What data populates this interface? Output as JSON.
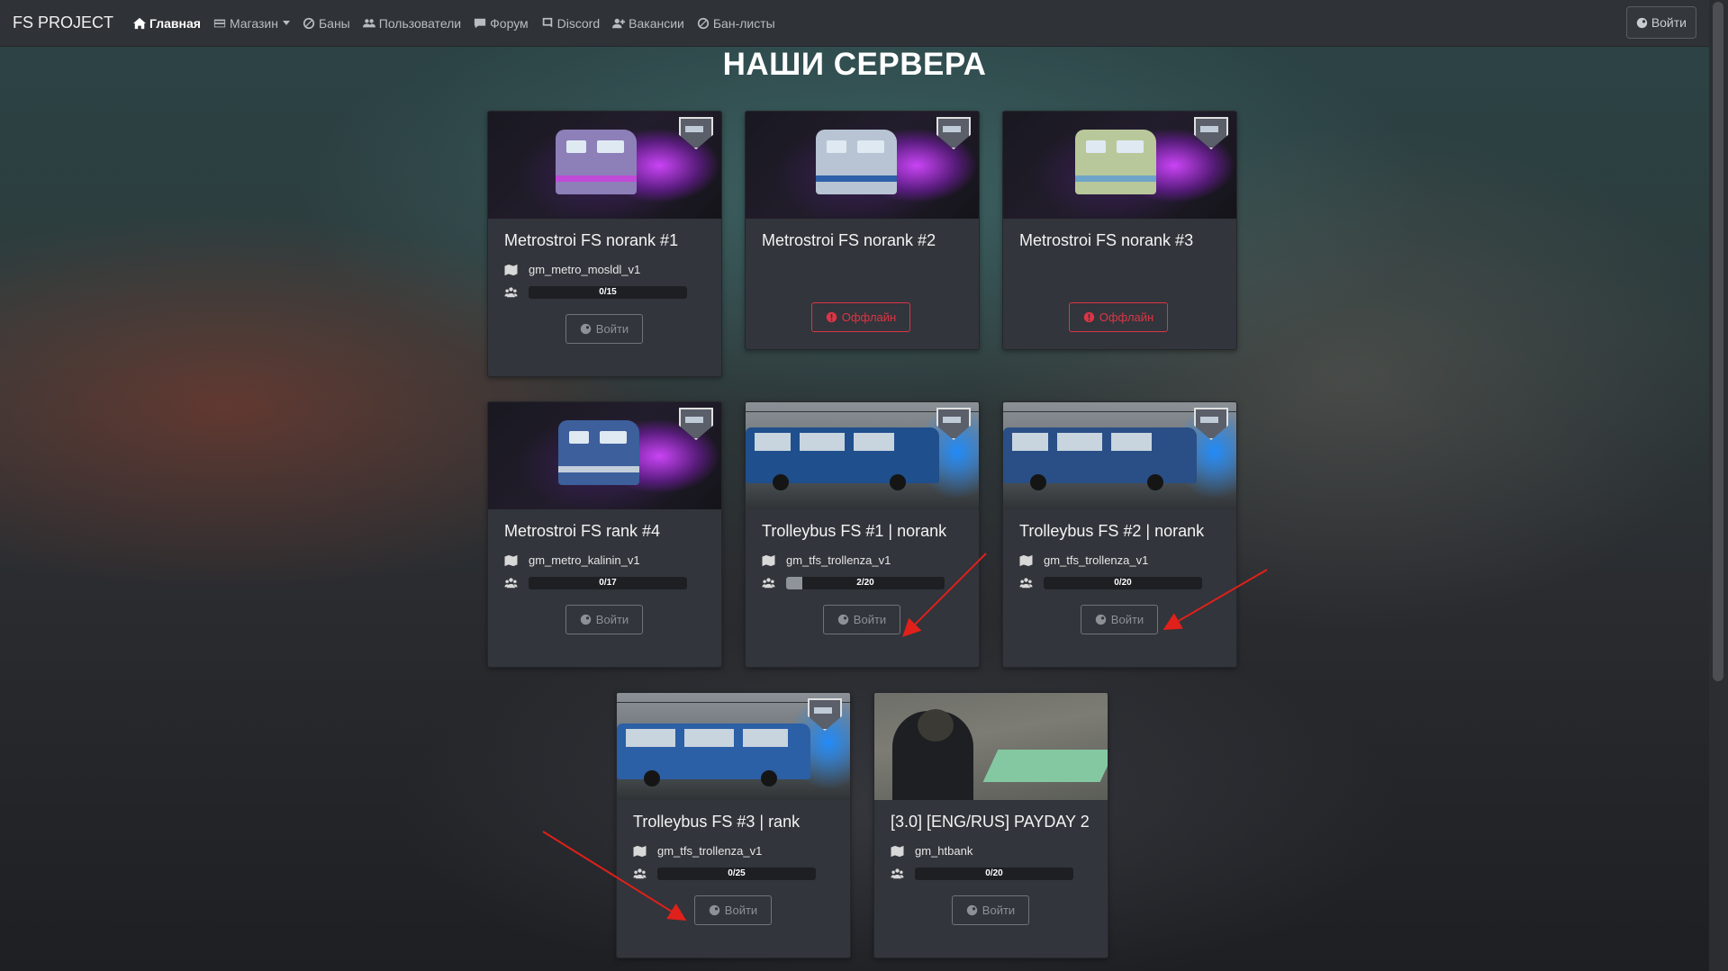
{
  "navbar": {
    "brand": "FS PROJECT",
    "items": [
      {
        "label": "Главная",
        "icon": "home-icon",
        "active": true
      },
      {
        "label": "Магазин",
        "icon": "store-icon",
        "dropdown": true
      },
      {
        "label": "Баны",
        "icon": "ban-icon"
      },
      {
        "label": "Пользователи",
        "icon": "users-icon"
      },
      {
        "label": "Форум",
        "icon": "comment-icon"
      },
      {
        "label": "Discord",
        "icon": "discord-icon"
      },
      {
        "label": "Вакансии",
        "icon": "user-plus-icon"
      },
      {
        "label": "Бан-листы",
        "icon": "ban-icon"
      }
    ],
    "login_label": "Войти"
  },
  "heading": "НАШИ СЕРВЕРА",
  "servers": [
    {
      "title": "Metrostroi FS norank #1",
      "map": "gm_metro_mosldl_v1",
      "players": "0/15",
      "fill": 0,
      "status": "online",
      "button": "Войти",
      "image": "metro-train-purple"
    },
    {
      "title": "Metrostroi FS norank #2",
      "status": "offline",
      "button": "Оффлайн",
      "image": "metro-train-white-blue"
    },
    {
      "title": "Metrostroi FS norank #3",
      "status": "offline",
      "button": "Оффлайн",
      "image": "metro-train-yellow-blue"
    },
    {
      "title": "Metrostroi FS rank #4",
      "map": "gm_metro_kalinin_v1",
      "players": "0/17",
      "fill": 0,
      "status": "online",
      "button": "Войти",
      "image": "metro-train-blue"
    },
    {
      "title": "Trolleybus FS #1 | norank",
      "map": "gm_tfs_trollenza_v1",
      "players": "2/20",
      "fill": 0.1,
      "status": "online",
      "button": "Войти",
      "image": "trolleybus-blue"
    },
    {
      "title": "Trolleybus FS #2 | norank",
      "map": "gm_tfs_trollenza_v1",
      "players": "0/20",
      "fill": 0,
      "status": "online",
      "button": "Войти",
      "image": "trolleybus-blue-depot"
    },
    {
      "title": "Trolleybus FS #3 | rank",
      "map": "gm_tfs_trollenza_v1",
      "players": "0/25",
      "fill": 0,
      "status": "online",
      "button": "Войти",
      "image": "trolleybus-modern"
    },
    {
      "title": "[3.0] [ENG/RUS] PAYDAY 2",
      "map": "gm_htbank",
      "players": "0/20",
      "fill": 0,
      "status": "online",
      "button": "Войти",
      "image": "payday-soldier"
    }
  ],
  "colors": {
    "offline": "#dc3545",
    "card": "#32353b",
    "navbar": "#2f3237"
  }
}
